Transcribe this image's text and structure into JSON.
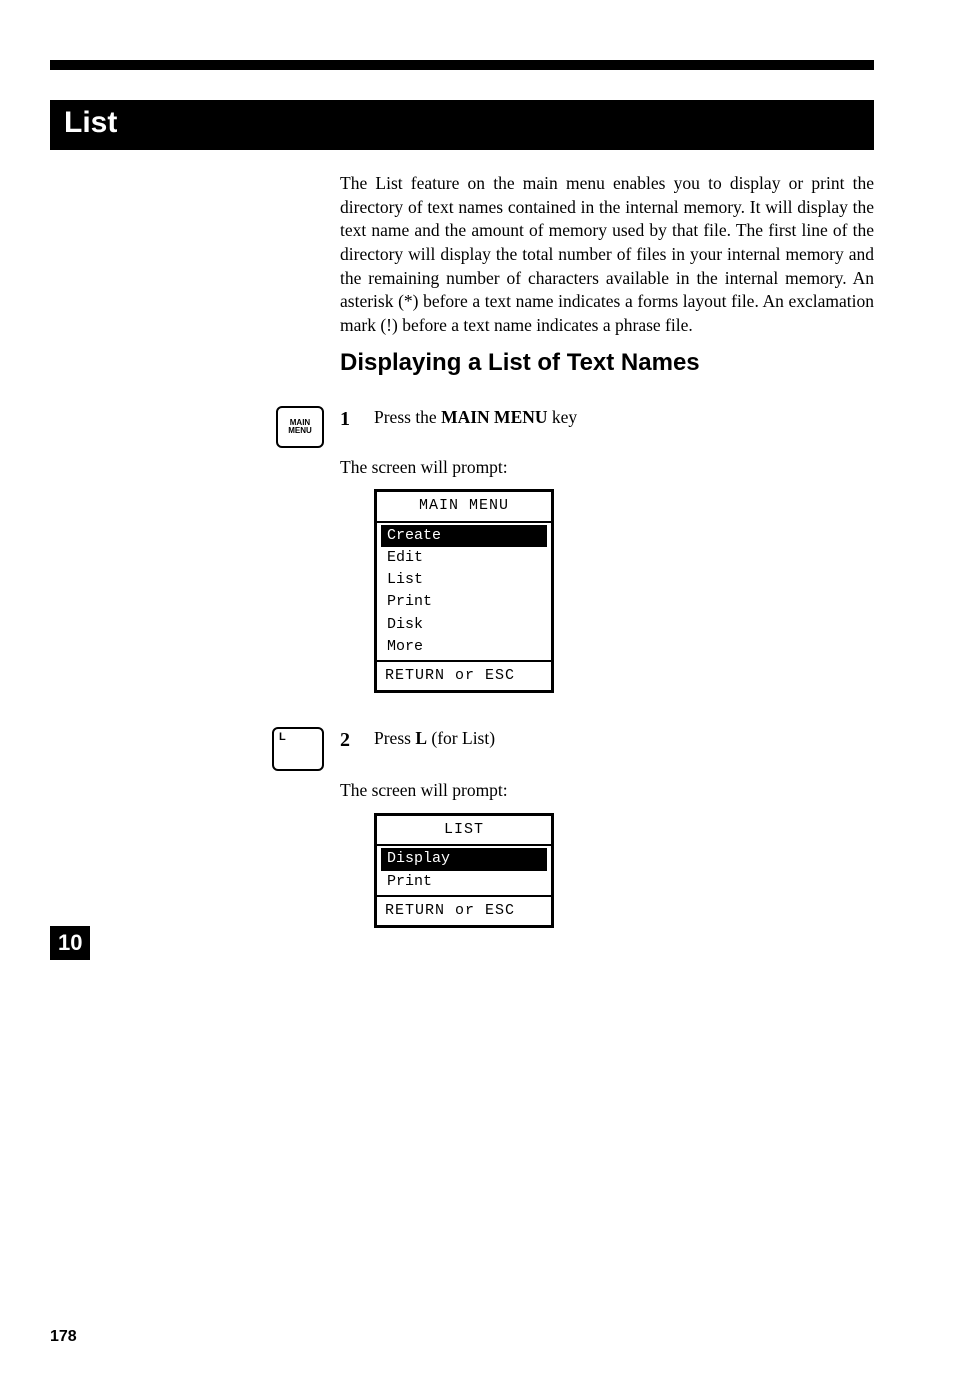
{
  "title": "List",
  "intro": "The List feature on the main menu enables you to display or print the directory of text names contained in the internal memory. It will display the text name and the amount of memory used by that file. The first line of the directory will display the total number of files in your internal memory and the remaining number of characters available in the internal memory. An asterisk (*) before a text name indicates a forms layout file. An exclamation mark (!) before a text name indicates a phrase file.",
  "section_heading": "Displaying a List of Text Names",
  "keys": {
    "main_menu_line1": "MAIN",
    "main_menu_line2": "MENU",
    "l_key": "L"
  },
  "steps": {
    "s1_num": "1",
    "s1_prefix": "Press the ",
    "s1_bold": "MAIN MENU",
    "s1_suffix": " key",
    "s1_prompt": "The screen will prompt:",
    "s2_num": "2",
    "s2_prefix": "Press ",
    "s2_bold": "L",
    "s2_suffix": " (for List)",
    "s2_prompt": "The screen will prompt:"
  },
  "screen1": {
    "title": "MAIN MENU",
    "items": [
      "Create",
      "Edit",
      "List",
      "Print",
      "Disk",
      "More"
    ],
    "footer": "RETURN or ESC"
  },
  "screen2": {
    "title": "LIST",
    "items": [
      "Display",
      "Print"
    ],
    "footer": "RETURN or ESC"
  },
  "side_tab": "10",
  "page_number": "178"
}
